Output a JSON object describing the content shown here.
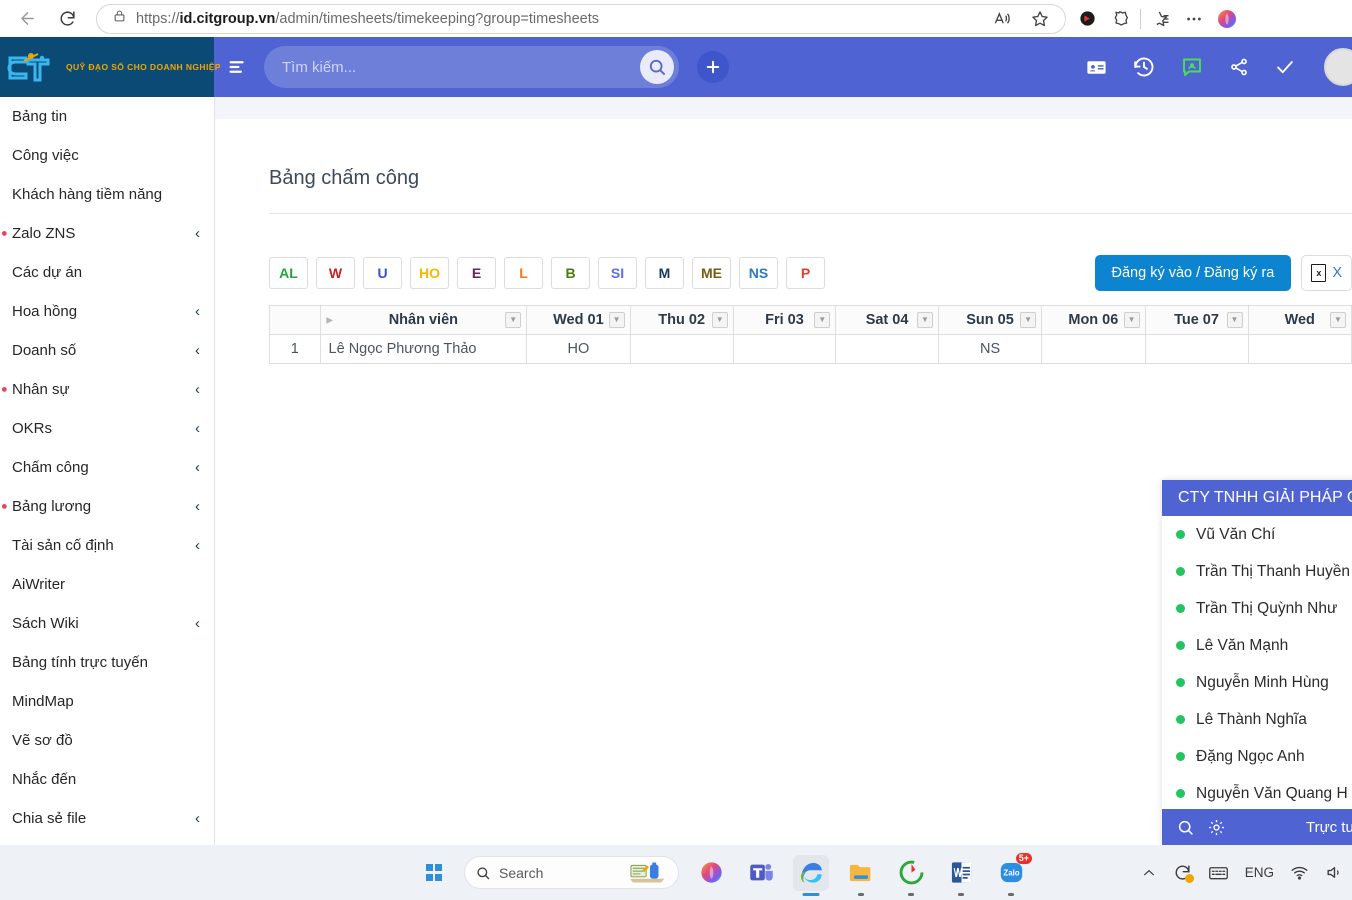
{
  "browser": {
    "url_prefix": "https://",
    "url_domain": "id.citgroup.vn",
    "url_path": "/admin/timesheets/timekeeping?group=timesheets",
    "back_icon": "back-arrow-icon",
    "reload_icon": "reload-icon",
    "lock_icon": "lock-icon",
    "read_aloud_icon": "read-aloud-icon",
    "favorite_icon": "star-icon",
    "browser_essentials_icon": "browser-essentials-icon",
    "split_icon": "split-screen-icon",
    "collections_icon": "collections-icon",
    "settings_icon": "more-options-icon",
    "copilot_icon": "copilot-icon"
  },
  "app_header": {
    "brand_tagline": "QUỸ ĐẠO SỐ CHO DOANH NGHIỆP",
    "brand_logo_text": "CIT",
    "menu_icon": "hamburger-menu-icon",
    "search_placeholder": "Tìm kiếm...",
    "search_value": "",
    "search_icon": "search-icon",
    "add_label": "+",
    "icons": [
      {
        "name": "id-card-icon"
      },
      {
        "name": "history-clock-icon"
      },
      {
        "name": "chat-bubble-icon"
      },
      {
        "name": "share-icon"
      },
      {
        "name": "check-icon"
      }
    ]
  },
  "sidebar": {
    "items": [
      {
        "label": "Bảng tin",
        "chevron": false,
        "dot": false
      },
      {
        "label": "Công việc",
        "chevron": false,
        "dot": false
      },
      {
        "label": "Khách hàng tiềm năng",
        "chevron": false,
        "dot": false
      },
      {
        "label": "Zalo ZNS",
        "chevron": true,
        "dot": true
      },
      {
        "label": "Các dự án",
        "chevron": false,
        "dot": false
      },
      {
        "label": "Hoa hồng",
        "chevron": true,
        "dot": false
      },
      {
        "label": "Doanh số",
        "chevron": true,
        "dot": false
      },
      {
        "label": "Nhân sự",
        "chevron": true,
        "dot": true
      },
      {
        "label": "OKRs",
        "chevron": true,
        "dot": false
      },
      {
        "label": "Chấm công",
        "chevron": true,
        "dot": false
      },
      {
        "label": "Bảng lương",
        "chevron": true,
        "dot": true
      },
      {
        "label": "Tài sản cố định",
        "chevron": true,
        "dot": false
      },
      {
        "label": "AiWriter",
        "chevron": false,
        "dot": false
      },
      {
        "label": "Sách Wiki",
        "chevron": true,
        "dot": false
      },
      {
        "label": "Bảng tính trực tuyến",
        "chevron": false,
        "dot": false
      },
      {
        "label": "MindMap",
        "chevron": false,
        "dot": false
      },
      {
        "label": "Vẽ sơ đồ",
        "chevron": false,
        "dot": false
      },
      {
        "label": "Nhắc đến",
        "chevron": false,
        "dot": false
      },
      {
        "label": "Chia sẻ file",
        "chevron": true,
        "dot": false
      }
    ],
    "chevron_glyph": "‹"
  },
  "main": {
    "page_title": "Bảng chấm công",
    "legend": [
      {
        "code": "AL",
        "color": "#22a63b"
      },
      {
        "code": "W",
        "color": "#c32626"
      },
      {
        "code": "U",
        "color": "#3b4fd6"
      },
      {
        "code": "HO",
        "color": "#f5b700"
      },
      {
        "code": "E",
        "color": "#6b2060"
      },
      {
        "code": "L",
        "color": "#f07820"
      },
      {
        "code": "B",
        "color": "#4a7a10"
      },
      {
        "code": "SI",
        "color": "#5b6ee8"
      },
      {
        "code": "M",
        "color": "#1b3a63"
      },
      {
        "code": "ME",
        "color": "#7a5a12"
      },
      {
        "code": "NS",
        "color": "#2b7bbd"
      },
      {
        "code": "P",
        "color": "#d8442a"
      }
    ],
    "checkin_label": "Đăng ký vào / Đăng ký ra",
    "export_label": "X",
    "export_icon": "excel-file-icon",
    "filter_glyph": "▼",
    "table": {
      "columns": [
        "",
        "Nhân viên",
        "Wed 01",
        "Thu 02",
        "Fri 03",
        "Sat 04",
        "Sun 05",
        "Mon 06",
        "Tue 07",
        "Wed"
      ],
      "rows": [
        {
          "index": "1",
          "employee": "Lê Ngọc Phương Thảo",
          "days": [
            "HO",
            "",
            "",
            "",
            "NS",
            "",
            "",
            ""
          ]
        }
      ]
    }
  },
  "chat_panel": {
    "title": "CTY TNHH GIẢI PHÁP C",
    "users": [
      "Vũ Văn Chí",
      "Trần Thị Thanh Huyền",
      "Trần Thị Quỳnh Như",
      "Lê Văn Mạnh",
      "Nguyễn Minh Hùng",
      "Lê Thành Nghĩa",
      "Đặng Ngọc Anh",
      "Nguyễn Văn Quang H"
    ],
    "footer_label": "Trực tuyến",
    "search_icon": "search-icon",
    "settings_icon": "gear-icon",
    "presence_color": "#22c55e"
  },
  "taskbar": {
    "start_icon": "windows-start-icon",
    "search_placeholder": "Search",
    "search_icon": "search-icon",
    "apps": [
      {
        "name": "copilot-icon",
        "active": false
      },
      {
        "name": "teams-icon",
        "active": false
      },
      {
        "name": "edge-icon",
        "active": true
      },
      {
        "name": "file-explorer-icon",
        "active": false
      },
      {
        "name": "misa-icon",
        "active": false
      },
      {
        "name": "word-icon",
        "active": false
      },
      {
        "name": "zalo-icon",
        "active": false,
        "badge": "5+"
      }
    ],
    "tray": {
      "overflow_icon": "chevron-up-icon",
      "sync_icon": "sync-icon",
      "keyboard_icon": "keyboard-icon",
      "language": "ENG",
      "wifi_icon": "wifi-icon",
      "volume_icon": "volume-icon"
    }
  }
}
